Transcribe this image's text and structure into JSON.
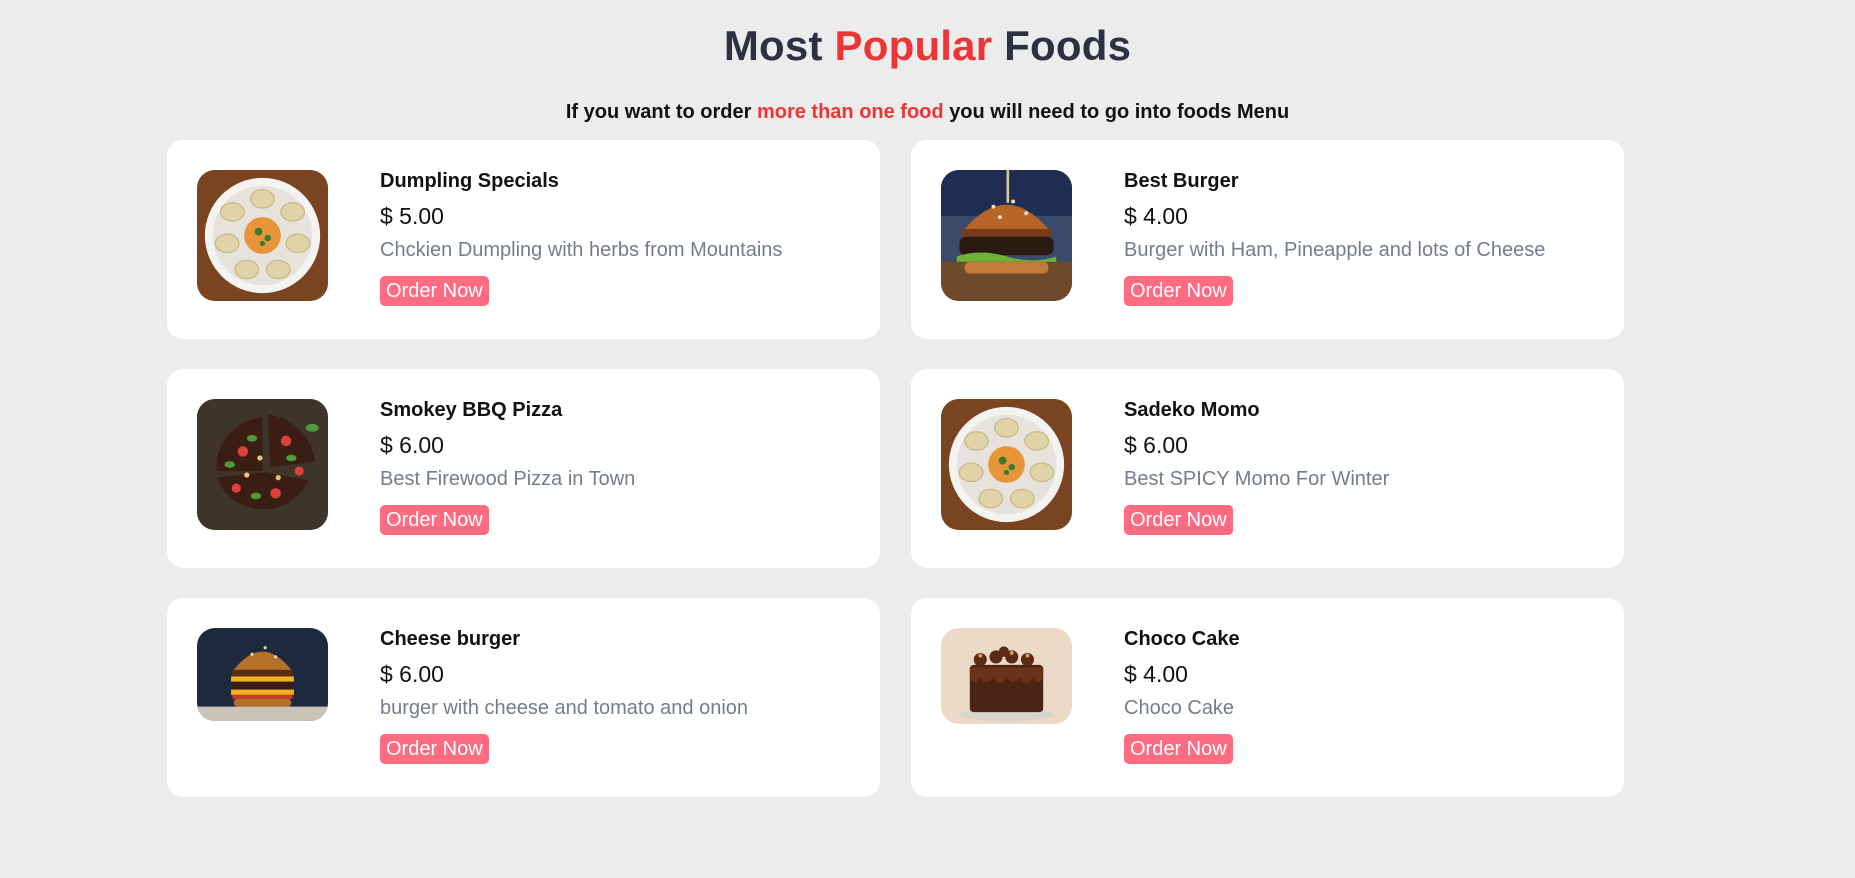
{
  "heading": {
    "part1": "Most",
    "accent": "Popular",
    "part2": "Foods"
  },
  "subheading": {
    "part1": "If you want to order",
    "accent": "more than one food",
    "part2": "you will need to go into foods Menu"
  },
  "foods": [
    {
      "name": "Dumpling Specials",
      "price": "$ 5.00",
      "description": "Chckien Dumpling with herbs from Mountains",
      "button": "Order Now",
      "image": "dumpling-plate"
    },
    {
      "name": "Best Burger",
      "price": "$ 4.00",
      "description": "Burger with Ham, Pineapple and lots of Cheese",
      "button": "Order Now",
      "image": "burger"
    },
    {
      "name": "Smokey BBQ Pizza",
      "price": "$ 6.00",
      "description": "Best Firewood Pizza in Town",
      "button": "Order Now",
      "image": "pizza"
    },
    {
      "name": "Sadeko Momo",
      "price": "$ 6.00",
      "description": "Best SPICY Momo For Winter",
      "button": "Order Now",
      "image": "dumpling-plate"
    },
    {
      "name": "Cheese burger",
      "price": "$ 6.00",
      "description": "burger with cheese and tomato and onion",
      "button": "Order Now",
      "image": "cheese-burger"
    },
    {
      "name": "Choco Cake",
      "price": "$ 4.00",
      "description": "Choco Cake",
      "button": "Order Now",
      "image": "chocolate-cake"
    }
  ],
  "colors": {
    "accent": "#ee3535",
    "button": "#ff6b81",
    "description": "#747d8c",
    "background": "#ececec"
  }
}
